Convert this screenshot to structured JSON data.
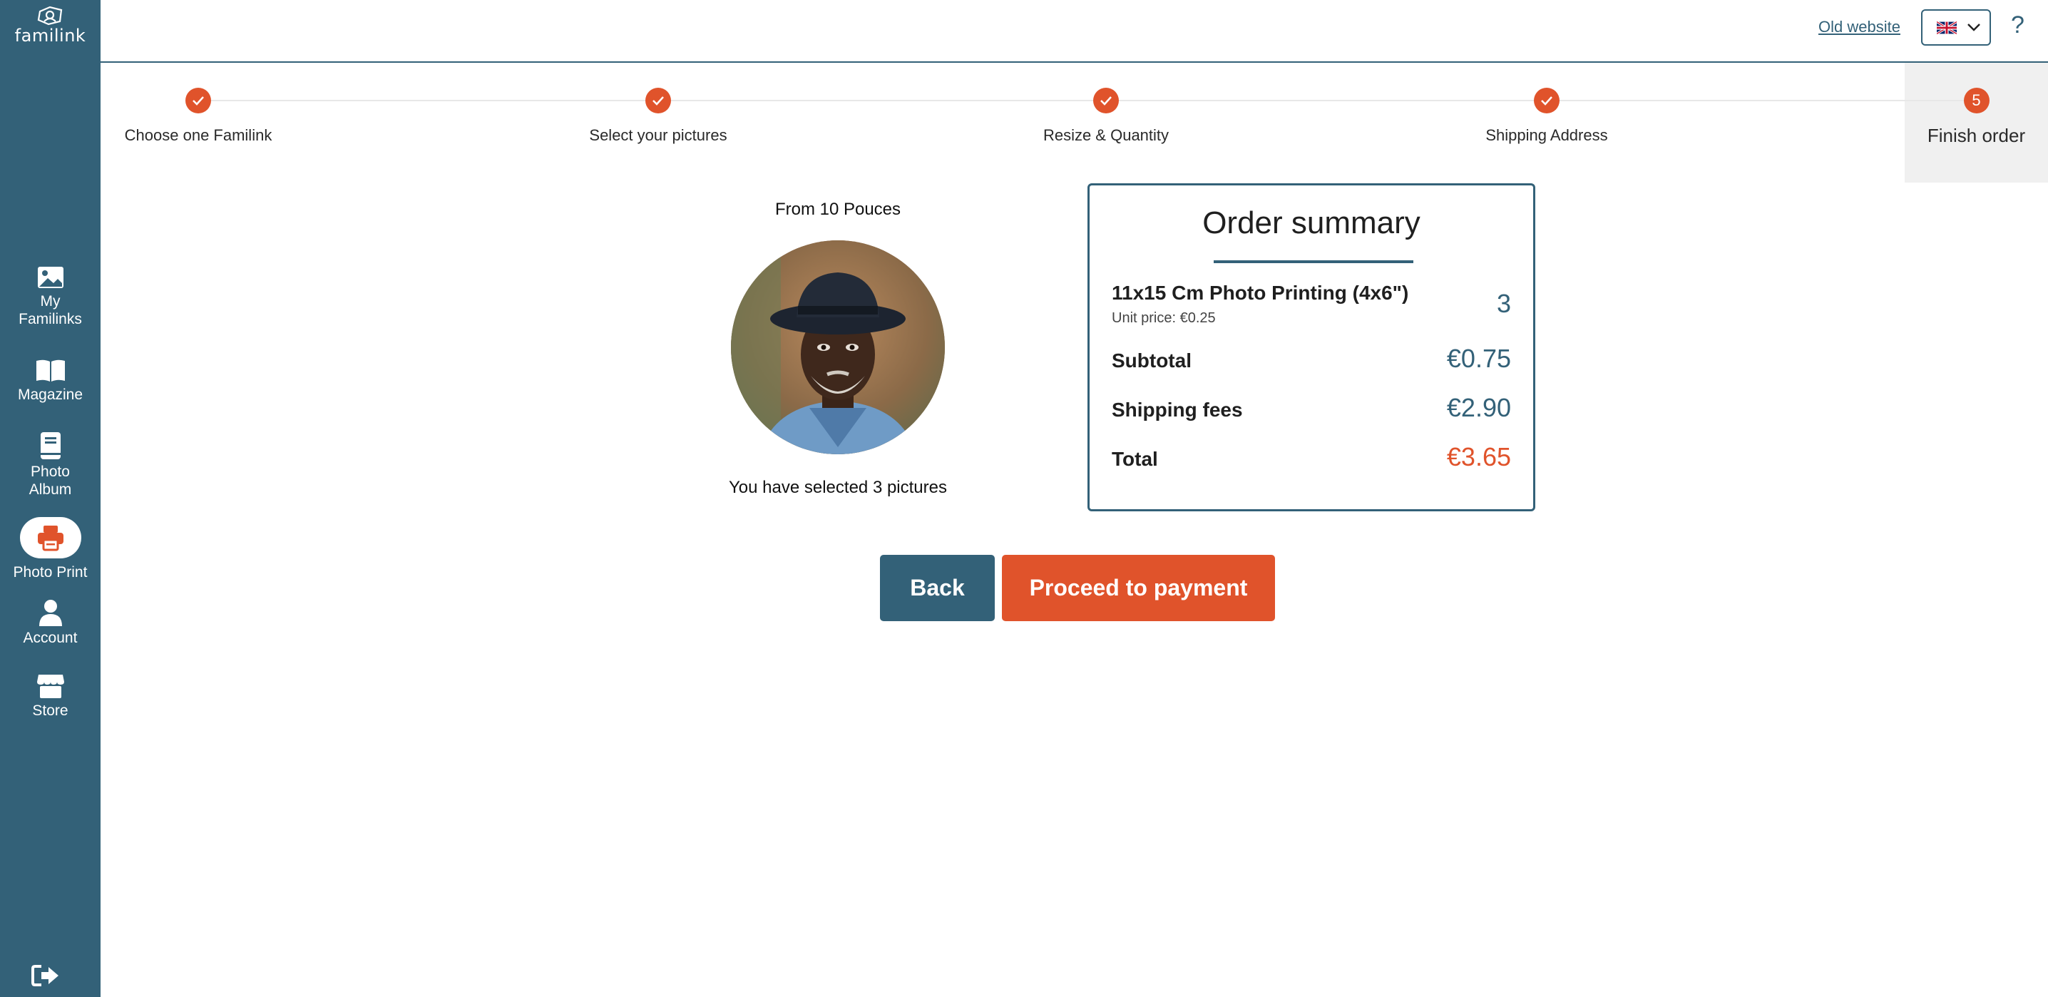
{
  "app": {
    "logo_text": "familink"
  },
  "sidebar": {
    "items": [
      {
        "label": "My\nFamilinks",
        "line1": "My",
        "line2": "Familinks",
        "icon": "image-icon"
      },
      {
        "label": "Magazine",
        "icon": "book-open-icon"
      },
      {
        "label": "Photo\nAlbum",
        "line1": "Photo",
        "line2": "Album",
        "icon": "album-icon"
      },
      {
        "label": "Photo Print",
        "icon": "printer-icon",
        "active": true
      },
      {
        "label": "Account",
        "icon": "user-icon"
      },
      {
        "label": "Store",
        "icon": "store-icon"
      }
    ],
    "logout_icon": "logout-icon"
  },
  "header": {
    "old_website": "Old website",
    "language_flag": "uk-flag-icon",
    "help": "?"
  },
  "stepper": {
    "steps": [
      {
        "label": "Choose one Familink",
        "state": "done"
      },
      {
        "label": "Select your pictures",
        "state": "done"
      },
      {
        "label": "Resize & Quantity",
        "state": "done"
      },
      {
        "label": "Shipping Address",
        "state": "done"
      },
      {
        "label": "Finish order",
        "state": "active",
        "number": "5"
      }
    ]
  },
  "preview": {
    "from": "From 10 Pouces",
    "selected": "You have selected 3 pictures"
  },
  "summary": {
    "title": "Order summary",
    "product": "11x15 Cm Photo Printing (4x6\")",
    "unit_price": "Unit price: €0.25",
    "quantity": "3",
    "subtotal_label": "Subtotal",
    "subtotal": "€0.75",
    "shipping_label": "Shipping fees",
    "shipping": "€2.90",
    "total_label": "Total",
    "total": "€3.65"
  },
  "actions": {
    "back": "Back",
    "pay": "Proceed to payment"
  },
  "colors": {
    "primary": "#336178",
    "accent": "#e0532b"
  }
}
